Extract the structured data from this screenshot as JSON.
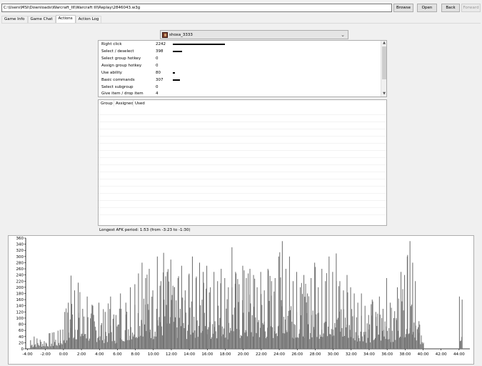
{
  "toolbar": {
    "path_value": "C:\\Users\\MSI\\Downloads\\Warcraft_III\\Warcraft III\\Replay\\2846043.w3g",
    "browse_label": "Browse",
    "open_label": "Open",
    "back_label": "Back",
    "forward_label": "Forward"
  },
  "tabs": [
    {
      "label": "Game Info"
    },
    {
      "label": "Game Chat"
    },
    {
      "label": "Actions"
    },
    {
      "label": "Action Log"
    }
  ],
  "player": {
    "name": "shoxa_3333",
    "icon": "hero-portrait-icon"
  },
  "actions": [
    {
      "label": "Right click",
      "value": "2242"
    },
    {
      "label": "Select / deselect",
      "value": "398"
    },
    {
      "label": "Select group hotkey",
      "value": "0"
    },
    {
      "label": "Assign group hotkey",
      "value": "0"
    },
    {
      "label": "Use ability",
      "value": "80"
    },
    {
      "label": "Basic commands",
      "value": "307"
    },
    {
      "label": "Select subgroup",
      "value": "0"
    },
    {
      "label": "Give item / drop item",
      "value": "4"
    }
  ],
  "group_table": {
    "columns": [
      "Group",
      "Assigned",
      "Used"
    ]
  },
  "afk_text": "Longest AFK period: 1:53 (from -3:23 to -1:30)",
  "chart_data": {
    "type": "bar",
    "ylim": [
      0,
      360
    ],
    "y_ticks": [
      "360",
      "340",
      "320",
      "300",
      "280",
      "260",
      "240",
      "220",
      "200",
      "180",
      "160",
      "140",
      "120",
      "100",
      "80",
      "60",
      "40",
      "20",
      "0"
    ],
    "x_ticks": [
      "-4:00",
      "-2:00",
      "0:00",
      "2:00",
      "4:00",
      "6:00",
      "8:00",
      "10:00",
      "12:00",
      "14:00",
      "16:00",
      "18:00",
      "20:00",
      "22:00",
      "24:00",
      "26:00",
      "28:00",
      "30:00",
      "32:00",
      "34:00",
      "36:00",
      "38:00",
      "40:00",
      "42:00",
      "44:00"
    ],
    "xlim_minutes": [
      -4.2,
      45.2
    ],
    "peaks": [
      {
        "t": -3.7,
        "v": 28
      },
      {
        "t": -3.3,
        "v": 40
      },
      {
        "t": -1.1,
        "v": 54
      },
      {
        "t": -0.4,
        "v": 62
      },
      {
        "t": 0.1,
        "v": 120
      },
      {
        "t": 0.5,
        "v": 150
      },
      {
        "t": 0.8,
        "v": 238
      },
      {
        "t": 1.2,
        "v": 190
      },
      {
        "t": 1.6,
        "v": 215
      },
      {
        "t": 2.1,
        "v": 130
      },
      {
        "t": 2.6,
        "v": 170
      },
      {
        "t": 3.2,
        "v": 140
      },
      {
        "t": 3.9,
        "v": 150
      },
      {
        "t": 4.6,
        "v": 120
      },
      {
        "t": 5.2,
        "v": 170
      },
      {
        "t": 5.8,
        "v": 110
      },
      {
        "t": 6.3,
        "v": 180
      },
      {
        "t": 6.9,
        "v": 150
      },
      {
        "t": 7.4,
        "v": 200
      },
      {
        "t": 7.9,
        "v": 210
      },
      {
        "t": 8.3,
        "v": 245
      },
      {
        "t": 8.7,
        "v": 280
      },
      {
        "t": 9.1,
        "v": 230
      },
      {
        "t": 9.5,
        "v": 260
      },
      {
        "t": 9.9,
        "v": 190
      },
      {
        "t": 10.4,
        "v": 300
      },
      {
        "t": 10.8,
        "v": 220
      },
      {
        "t": 11.1,
        "v": 312
      },
      {
        "t": 11.5,
        "v": 250
      },
      {
        "t": 11.9,
        "v": 290
      },
      {
        "t": 12.3,
        "v": 200
      },
      {
        "t": 12.7,
        "v": 230
      },
      {
        "t": 13.1,
        "v": 270
      },
      {
        "t": 13.5,
        "v": 190
      },
      {
        "t": 13.9,
        "v": 240
      },
      {
        "t": 14.3,
        "v": 300
      },
      {
        "t": 14.7,
        "v": 230
      },
      {
        "t": 15.1,
        "v": 280
      },
      {
        "t": 15.5,
        "v": 250
      },
      {
        "t": 15.9,
        "v": 270
      },
      {
        "t": 16.3,
        "v": 200
      },
      {
        "t": 16.7,
        "v": 250
      },
      {
        "t": 17.1,
        "v": 220
      },
      {
        "t": 17.5,
        "v": 260
      },
      {
        "t": 17.9,
        "v": 230
      },
      {
        "t": 18.3,
        "v": 200
      },
      {
        "t": 18.7,
        "v": 330
      },
      {
        "t": 19.1,
        "v": 250
      },
      {
        "t": 19.5,
        "v": 210
      },
      {
        "t": 19.9,
        "v": 270
      },
      {
        "t": 20.3,
        "v": 230
      },
      {
        "t": 20.7,
        "v": 260
      },
      {
        "t": 21.1,
        "v": 240
      },
      {
        "t": 21.5,
        "v": 200
      },
      {
        "t": 21.9,
        "v": 250
      },
      {
        "t": 22.3,
        "v": 190
      },
      {
        "t": 22.7,
        "v": 260
      },
      {
        "t": 23.1,
        "v": 220
      },
      {
        "t": 23.5,
        "v": 230
      },
      {
        "t": 23.9,
        "v": 300
      },
      {
        "t": 24.3,
        "v": 350
      },
      {
        "t": 24.7,
        "v": 260
      },
      {
        "t": 25.1,
        "v": 300
      },
      {
        "t": 25.5,
        "v": 220
      },
      {
        "t": 25.9,
        "v": 250
      },
      {
        "t": 26.3,
        "v": 200
      },
      {
        "t": 26.7,
        "v": 240
      },
      {
        "t": 27.1,
        "v": 180
      },
      {
        "t": 27.5,
        "v": 230
      },
      {
        "t": 27.9,
        "v": 280
      },
      {
        "t": 28.3,
        "v": 200
      },
      {
        "t": 28.7,
        "v": 260
      },
      {
        "t": 29.1,
        "v": 220
      },
      {
        "t": 29.5,
        "v": 300
      },
      {
        "t": 29.9,
        "v": 250
      },
      {
        "t": 30.3,
        "v": 310
      },
      {
        "t": 30.7,
        "v": 220
      },
      {
        "t": 31.1,
        "v": 190
      },
      {
        "t": 31.5,
        "v": 240
      },
      {
        "t": 31.9,
        "v": 200
      },
      {
        "t": 32.3,
        "v": 180
      },
      {
        "t": 32.7,
        "v": 150
      },
      {
        "t": 33.1,
        "v": 180
      },
      {
        "t": 33.5,
        "v": 140
      },
      {
        "t": 33.9,
        "v": 110
      },
      {
        "t": 34.3,
        "v": 160
      },
      {
        "t": 34.7,
        "v": 120
      },
      {
        "t": 35.1,
        "v": 170
      },
      {
        "t": 35.5,
        "v": 130
      },
      {
        "t": 35.9,
        "v": 230
      },
      {
        "t": 36.3,
        "v": 150
      },
      {
        "t": 36.7,
        "v": 100
      },
      {
        "t": 37.1,
        "v": 200
      },
      {
        "t": 37.5,
        "v": 250
      },
      {
        "t": 37.9,
        "v": 240
      },
      {
        "t": 38.2,
        "v": 300
      },
      {
        "t": 38.5,
        "v": 350
      },
      {
        "t": 38.8,
        "v": 280
      },
      {
        "t": 39.1,
        "v": 220
      },
      {
        "t": 39.5,
        "v": 90
      },
      {
        "t": 40.0,
        "v": 20
      },
      {
        "t": 44.0,
        "v": 170
      },
      {
        "t": 44.3,
        "v": 160
      }
    ]
  }
}
